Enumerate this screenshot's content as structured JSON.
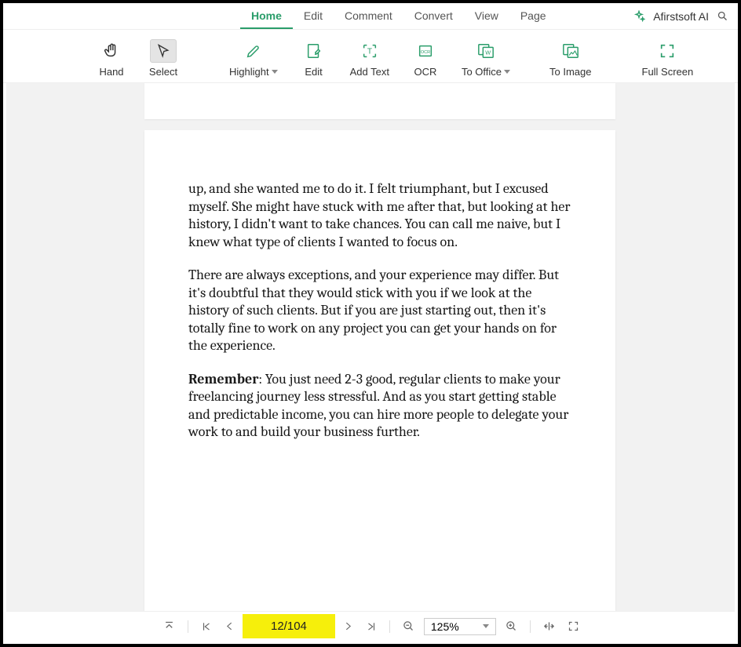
{
  "menu": {
    "tabs": [
      "Home",
      "Edit",
      "Comment",
      "Convert",
      "View",
      "Page"
    ],
    "active_index": 0,
    "ai_label": "Afirstsoft AI"
  },
  "toolbar": {
    "hand": "Hand",
    "select": "Select",
    "highlight": "Highlight",
    "edit": "Edit",
    "add_text": "Add Text",
    "ocr": "OCR",
    "to_office": "To Office",
    "to_image": "To Image",
    "full_screen": "Full Screen"
  },
  "document": {
    "para1": "up, and she wanted me to do it. I felt triumphant, but I excused myself. She might have stuck with me after that, but looking at her history, I didn't want to take chances. You can call me naive, but I knew what type of clients I wanted to focus on.",
    "para2": "There are always exceptions, and your experience may differ. But it's doubtful that they would stick with you if we look at the history of such clients. But if you are just starting out, then it's totally fine to work on any project you can get your hands on for the experience.",
    "para3_bold": "Remember",
    "para3_rest": ": You just need 2-3 good, regular clients to make your freelancing journey less stressful. And as you start getting stable and predictable income, you can hire more people to delegate your work to and build your business further."
  },
  "status": {
    "page_indicator": "12/104",
    "zoom": "125%"
  }
}
